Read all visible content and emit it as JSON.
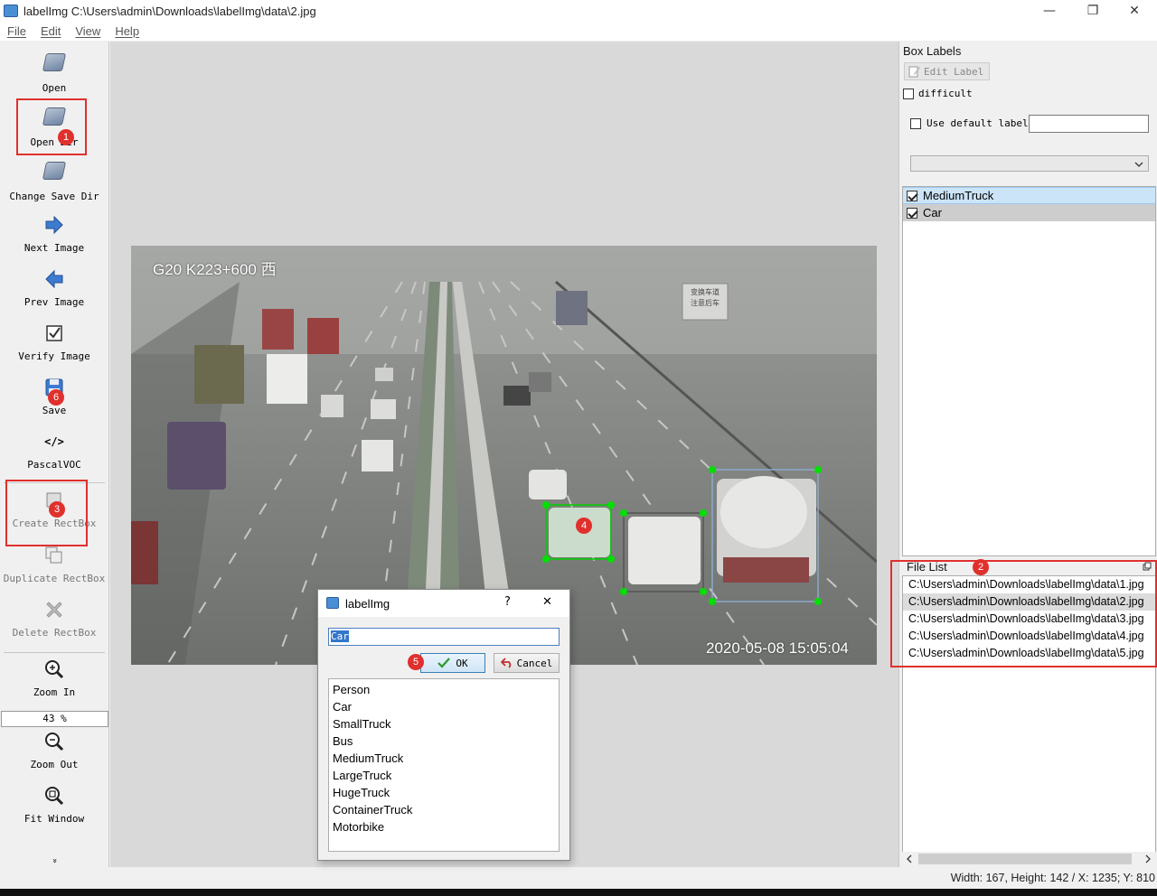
{
  "window": {
    "title": "labelImg C:\\Users\\admin\\Downloads\\labelImg\\data\\2.jpg",
    "minimize": "—",
    "restore": "❐",
    "close": "✕"
  },
  "menu": [
    "File",
    "Edit",
    "View",
    "Help"
  ],
  "toolbar": {
    "open": "Open",
    "open_dir": "Open Dir",
    "change_save_dir": "Change Save Dir",
    "next_image": "Next Image",
    "prev_image": "Prev Image",
    "verify_image": "Verify Image",
    "save": "Save",
    "format_icon": "</>",
    "format": "PascalVOC",
    "create_rectbox": "Create RectBox",
    "duplicate_rectbox": "Duplicate RectBox",
    "delete_rectbox": "Delete RectBox",
    "zoom_in": "Zoom In",
    "zoom_value": "43 %",
    "zoom_out": "Zoom Out",
    "fit_window": "Fit Window",
    "more": "»"
  },
  "annotations": {
    "badges": [
      "1",
      "2",
      "3",
      "4",
      "5",
      "6"
    ]
  },
  "scene": {
    "overlay_top": "G20 K223+600 西",
    "overlay_bottom": "2020-05-08 15:05:04",
    "sign": "变换车道\n注意后车"
  },
  "box_labels": {
    "title": "Box Labels",
    "edit_label": "Edit Label",
    "difficult": "difficult",
    "use_default_label": "Use default label",
    "default_label_value": "",
    "labels": [
      {
        "name": "MediumTruck",
        "checked": true
      },
      {
        "name": "Car",
        "checked": true
      }
    ]
  },
  "file_list": {
    "title": "File List",
    "files": [
      "C:\\Users\\admin\\Downloads\\labelImg\\data\\1.jpg",
      "C:\\Users\\admin\\Downloads\\labelImg\\data\\2.jpg",
      "C:\\Users\\admin\\Downloads\\labelImg\\data\\3.jpg",
      "C:\\Users\\admin\\Downloads\\labelImg\\data\\4.jpg",
      "C:\\Users\\admin\\Downloads\\labelImg\\data\\5.jpg"
    ],
    "selected_index": 1
  },
  "dialog": {
    "title": "labelImg",
    "help": "?",
    "close": "✕",
    "input_value": "Car",
    "ok": "OK",
    "cancel": "Cancel",
    "classes": [
      "Person",
      "Car",
      "SmallTruck",
      "Bus",
      "MediumTruck",
      "LargeTruck",
      "HugeTruck",
      "ContainerTruck",
      "Motorbike"
    ]
  },
  "status": "Width: 167, Height: 142 / X: 1235; Y: 810",
  "colors": {
    "highlight_red": "#e0302d",
    "box_selected": "#00e000",
    "box_car": "#555555",
    "box_truck": "#8aa9cc",
    "selection_blue": "#cce4f7"
  }
}
